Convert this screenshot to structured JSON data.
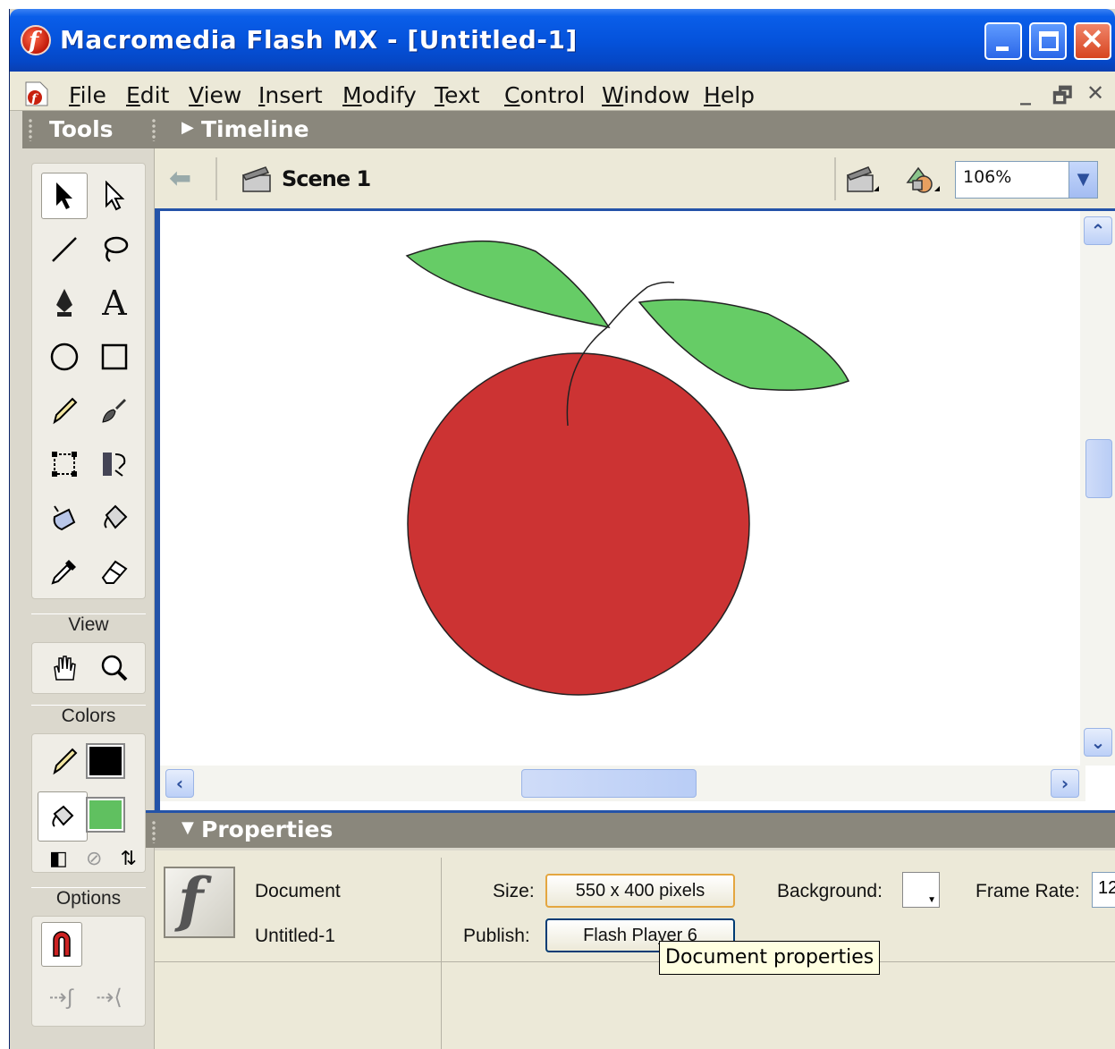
{
  "window": {
    "title": "Macromedia Flash MX - [Untitled-1]"
  },
  "menubar": {
    "items": [
      {
        "first": "F",
        "rest": "ile"
      },
      {
        "first": "E",
        "rest": "dit"
      },
      {
        "first": "V",
        "rest": "iew"
      },
      {
        "first": "I",
        "rest": "nsert"
      },
      {
        "first": "M",
        "rest": "odify"
      },
      {
        "first": "T",
        "rest": "ext"
      },
      {
        "first": "C",
        "rest": "ontrol"
      },
      {
        "first": "W",
        "rest": "indow"
      },
      {
        "first": "H",
        "rest": "elp"
      }
    ],
    "doc_controls": [
      "_",
      "🗗",
      "✕"
    ]
  },
  "tools_panel": {
    "title": "Tools",
    "view_label": "View",
    "colors_label": "Colors",
    "options_label": "Options",
    "stroke_color": "#000000",
    "fill_color": "#60c060"
  },
  "timeline": {
    "title": "Timeline"
  },
  "edit_bar": {
    "scene": "Scene 1",
    "zoom": "106%"
  },
  "stage": {
    "apple_color": "#cc3333",
    "leaf_color": "#66cc66"
  },
  "properties": {
    "title": "Properties",
    "type": "Document",
    "name": "Untitled-1",
    "size_label": "Size:",
    "size_value": "550 x 400 pixels",
    "publish_label": "Publish:",
    "publish_value": "Flash Player 6",
    "background_label": "Background:",
    "framerate_label": "Frame Rate:",
    "framerate_value": "12",
    "tooltip": "Document properties"
  }
}
